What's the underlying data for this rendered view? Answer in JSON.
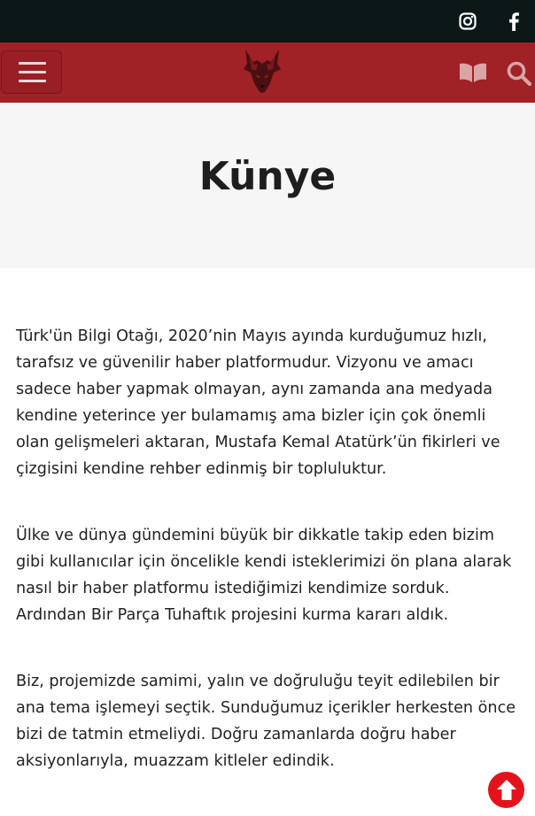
{
  "topbar": {
    "social": [
      {
        "icon": "instagram-icon",
        "label": "Instagram"
      },
      {
        "icon": "facebook-icon",
        "label": "Facebook"
      }
    ]
  },
  "navbar": {
    "menu_icon": "hamburger-menu-icon",
    "logo_icon": "wolf-head-logo",
    "book_icon": "open-book-icon",
    "search_icon": "search-icon"
  },
  "page": {
    "title": "Künye"
  },
  "content": {
    "paragraphs": [
      "Türk'ün Bilgi Otağı, 2020’nin Mayıs ayında kurduğumuz hızlı, tarafsız ve güvenilir haber platformudur. Vizyonu ve amacı sadece haber yapmak olmayan, aynı zamanda ana medyada kendine yeterince yer bulamamış ama bizler için çok önemli olan gelişmeleri aktaran, Mustafa Kemal Atatürk’ün fikirleri ve çizgisini kendine rehber edinmiş bir topluluktur.",
      "Ülke ve dünya gündemini büyük bir dikkatle takip eden bizim gibi kullanıcılar için öncelikle kendi isteklerimizi ön plana alarak nasıl bir haber platformu istediğimizi kendimize sorduk. Ardından Bir Parça Tuhaftık projesini kurma kararı aldık.",
      "Biz, projemizde samimi, yalın ve doğruluğu teyit edilebilen bir ana tema işlemeyi seçtik. Sunduğumuz içerikler herkesten önce bizi de tatmin etmeliydi. Doğru zamanlarda doğru haber aksiyonlarıyla, muazzam kitleler edindik."
    ]
  },
  "scroll_top": {
    "icon": "arrow-up-circle-icon"
  },
  "colors": {
    "topbar_bg": "#0c1718",
    "navbar_bg": "#a02126",
    "hero_bg": "#f6f6f6",
    "scroll_top_bg": "#e2141b"
  }
}
